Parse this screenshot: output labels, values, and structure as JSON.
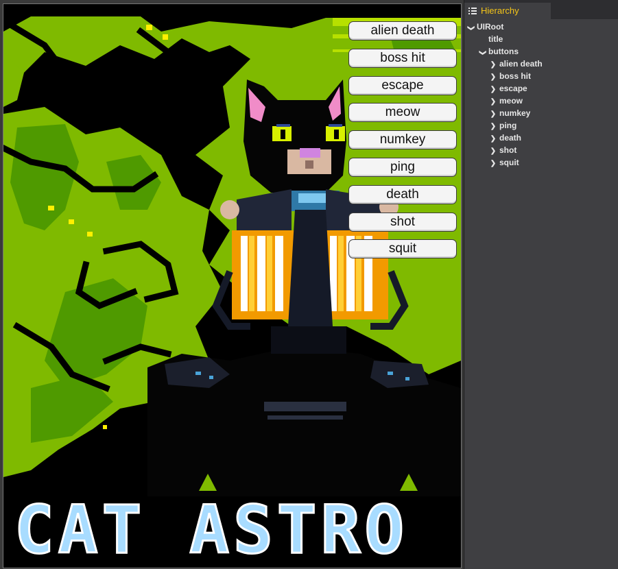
{
  "game": {
    "title_banner": "CAT ASTRO"
  },
  "buttons": [
    {
      "label": "alien death"
    },
    {
      "label": "boss hit"
    },
    {
      "label": "escape"
    },
    {
      "label": "meow"
    },
    {
      "label": "numkey"
    },
    {
      "label": "ping"
    },
    {
      "label": "death"
    },
    {
      "label": "shot"
    },
    {
      "label": "squit"
    }
  ],
  "hierarchy": {
    "tab_label": "Hierarchy",
    "root": "UIRoot",
    "title_node": "title",
    "buttons_node": "buttons",
    "children": [
      "alien death",
      "boss hit",
      "escape",
      "meow",
      "numkey",
      "ping",
      "death",
      "shot",
      "squit"
    ]
  },
  "colors": {
    "accent": "#f5c518",
    "jungle_light": "#7fba00",
    "jungle_dark": "#3f8a00",
    "title_text": "#a8dcff"
  }
}
